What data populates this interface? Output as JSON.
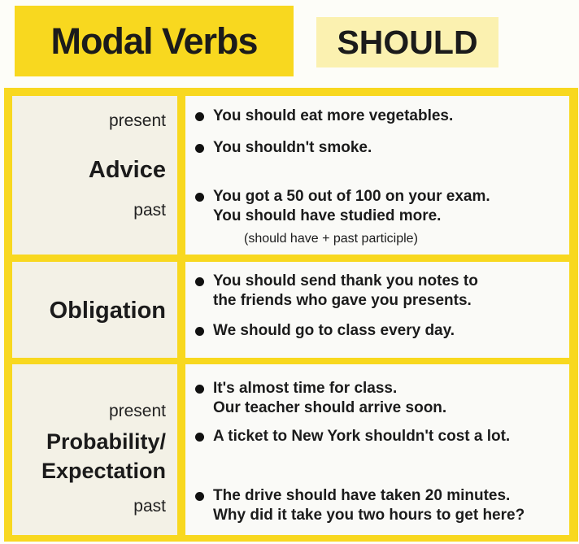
{
  "title": "Modal Verbs",
  "subtitle": "SHOULD",
  "rows": [
    {
      "category": "Advice",
      "labels": {
        "present": "present",
        "past": "past"
      },
      "items": [
        "You should eat more vegetables.",
        "You shouldn't smoke.",
        "You got a 50 out of 100 on your exam.\nYou should have studied more."
      ],
      "note": "(should have + past participle)"
    },
    {
      "category": "Obligation",
      "items": [
        "You should send thank you notes to\nthe friends who gave you presents.",
        "We should go to class every day."
      ]
    },
    {
      "category_line1": "Probability/",
      "category_line2": "Expectation",
      "labels": {
        "present": "present",
        "past": "past"
      },
      "items": [
        "It's almost time for class.\nOur teacher should arrive soon.",
        "A ticket to New York shouldn't cost a lot.",
        "The drive should have taken 20 minutes.\nWhy did it take you two hours to get here?"
      ]
    }
  ]
}
